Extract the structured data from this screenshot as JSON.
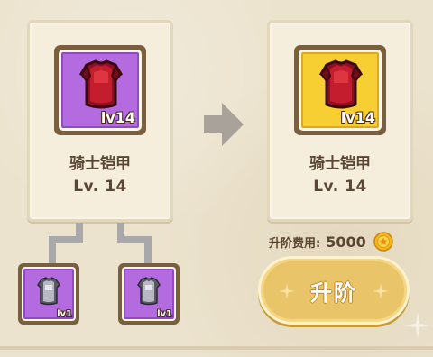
{
  "source_item": {
    "name": "骑士铠甲",
    "level_text": "Lv. 14",
    "badge": "lv14",
    "rarity": "purple",
    "icon": "red-armor-icon"
  },
  "target_item": {
    "name": "骑士铠甲",
    "level_text": "Lv. 14",
    "badge": "lv14",
    "rarity": "gold",
    "icon": "red-armor-icon"
  },
  "materials": [
    {
      "badge": "lv1",
      "icon": "gray-vest-icon",
      "rarity": "purple"
    },
    {
      "badge": "lv1",
      "icon": "gray-vest-icon",
      "rarity": "purple"
    }
  ],
  "cost": {
    "label": "升阶费用:",
    "value": "5000",
    "currency_icon": "gold-coin-icon"
  },
  "upgrade_button": {
    "label": "升阶"
  },
  "colors": {
    "purple_rarity": "#b56be0",
    "gold_rarity": "#f7cf33",
    "frame": "#7a5f3e",
    "text": "#5a4632",
    "button": "#e9c469"
  }
}
